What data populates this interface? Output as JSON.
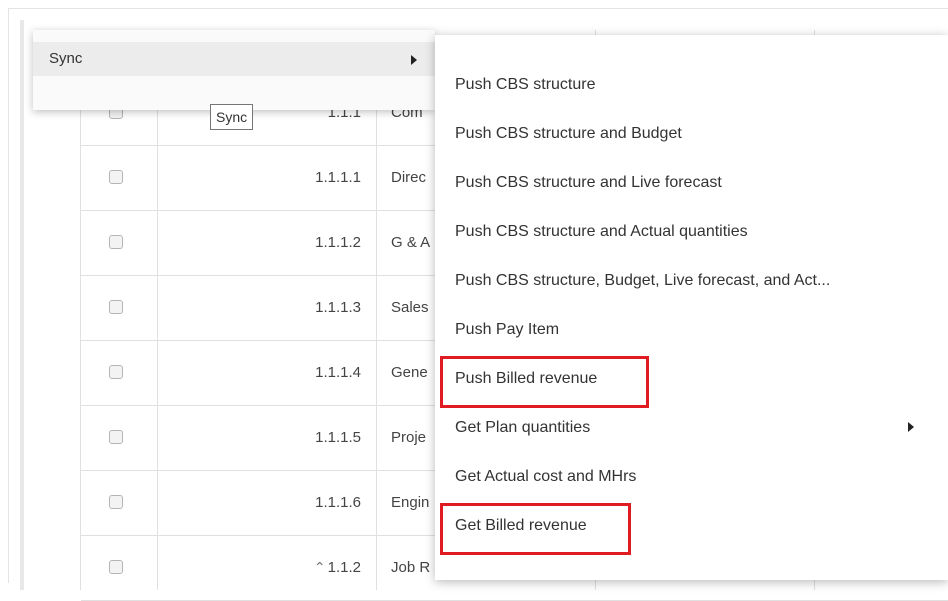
{
  "sync_menu": {
    "label": "Sync",
    "tooltip": "Sync",
    "submenu_arrow_icon": "caret-right-icon"
  },
  "table": {
    "rows": [
      {
        "code": "1.1.1",
        "desc": "Com",
        "has_caret": false
      },
      {
        "code": "1.1.1.1",
        "desc": "Direc",
        "has_caret": false
      },
      {
        "code": "1.1.1.2",
        "desc": "G & A",
        "has_caret": false
      },
      {
        "code": "1.1.1.3",
        "desc": "Sales",
        "has_caret": false
      },
      {
        "code": "1.1.1.4",
        "desc": "Gene",
        "has_caret": false
      },
      {
        "code": "1.1.1.5",
        "desc": "Proje",
        "has_caret": false
      },
      {
        "code": "1.1.1.6",
        "desc": "Engin",
        "has_caret": false
      },
      {
        "code": "1.1.2",
        "desc": "Job R",
        "has_caret": true,
        "caret_icon": "chevron-up-icon"
      }
    ]
  },
  "submenu": {
    "items": [
      {
        "label": "Push CBS structure",
        "has_arrow": false,
        "highlighted": false
      },
      {
        "label": "Push CBS structure and Budget",
        "has_arrow": false,
        "highlighted": false
      },
      {
        "label": "Push CBS structure and Live forecast",
        "has_arrow": false,
        "highlighted": false
      },
      {
        "label": "Push CBS structure and Actual quantities",
        "has_arrow": false,
        "highlighted": false
      },
      {
        "label": "Push CBS structure, Budget, Live forecast, and Act...",
        "has_arrow": false,
        "highlighted": false
      },
      {
        "label": "Push Pay Item",
        "has_arrow": false,
        "highlighted": false
      },
      {
        "label": "Push Billed revenue",
        "has_arrow": false,
        "highlighted": true
      },
      {
        "label": "Get Plan quantities",
        "has_arrow": true,
        "highlighted": false
      },
      {
        "label": "Get Actual cost and MHrs",
        "has_arrow": false,
        "highlighted": false
      },
      {
        "label": "Get Billed revenue",
        "has_arrow": false,
        "highlighted": true
      }
    ]
  },
  "colors": {
    "highlight_border": "#e11b22",
    "menu_hover": "#ececec"
  }
}
